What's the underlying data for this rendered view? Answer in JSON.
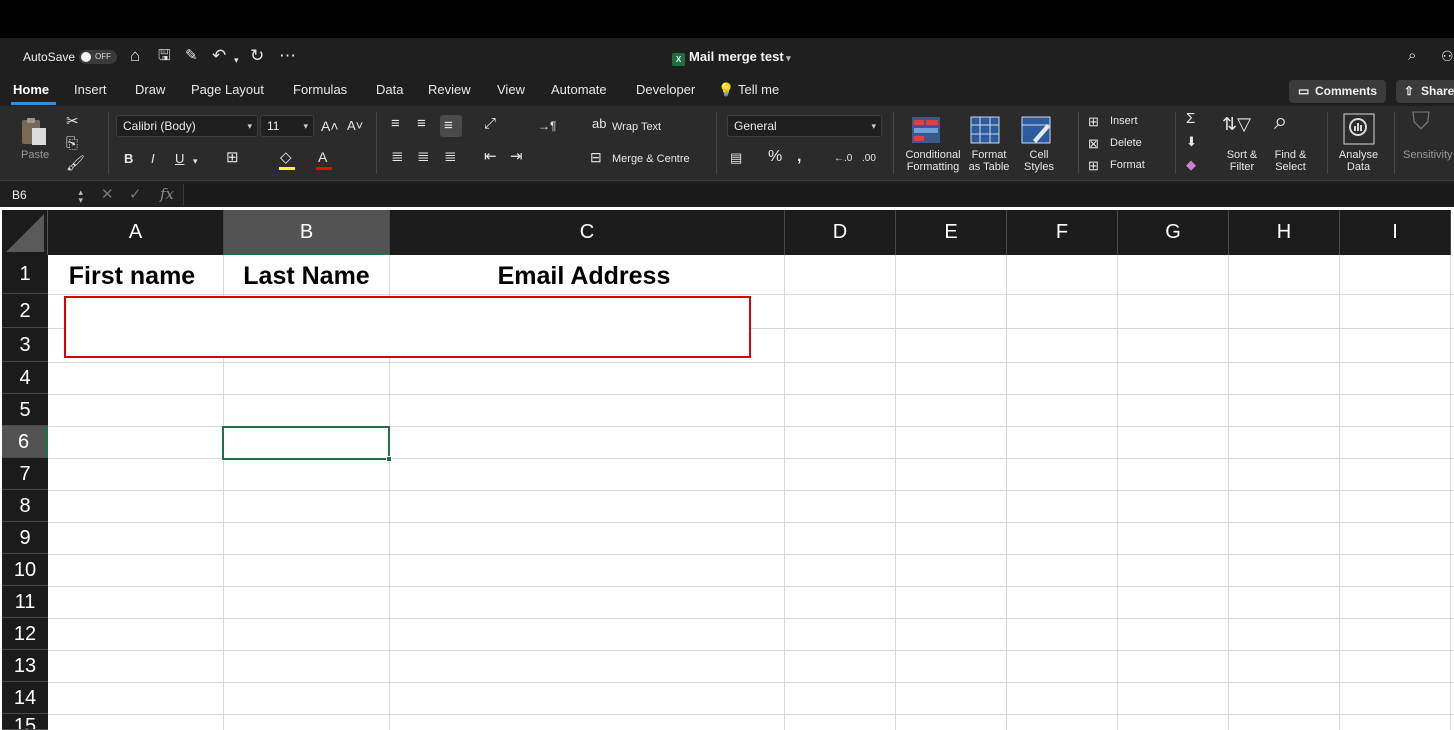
{
  "title_bar": {
    "autosave_label": "AutoSave",
    "autosave_state": "OFF",
    "document_title": "Mail merge test"
  },
  "tabs": [
    {
      "label": "Home",
      "active": true
    },
    {
      "label": "Insert"
    },
    {
      "label": "Draw"
    },
    {
      "label": "Page Layout"
    },
    {
      "label": "Formulas"
    },
    {
      "label": "Data"
    },
    {
      "label": "Review"
    },
    {
      "label": "View"
    },
    {
      "label": "Automate"
    },
    {
      "label": "Developer"
    },
    {
      "label": "Tell me"
    }
  ],
  "header_buttons": {
    "comments": "Comments",
    "share": "Share"
  },
  "ribbon": {
    "paste": "Paste",
    "font_name": "Calibri (Body)",
    "font_size": "11",
    "wrap_text": "Wrap Text",
    "merge_centre": "Merge & Centre",
    "number_format": "General",
    "conditional_formatting": [
      "Conditional",
      "Formatting"
    ],
    "format_as_table": [
      "Format",
      "as Table"
    ],
    "cell_styles": [
      "Cell",
      "Styles"
    ],
    "insert": "Insert",
    "delete": "Delete",
    "format": "Format",
    "sort_filter": [
      "Sort &",
      "Filter"
    ],
    "find_select": [
      "Find &",
      "Select"
    ],
    "analyse_data": [
      "Analyse",
      "Data"
    ],
    "sensitivity": "Sensitivity"
  },
  "formula_bar": {
    "name_box": "B6",
    "fx": "fx",
    "value": ""
  },
  "sheet": {
    "columns": [
      "A",
      "B",
      "C",
      "D",
      "E",
      "F",
      "G",
      "H",
      "I"
    ],
    "selected_column": "B",
    "rows": [
      "1",
      "2",
      "3",
      "4",
      "5",
      "6",
      "7",
      "8",
      "9",
      "10",
      "11",
      "12",
      "13",
      "14",
      "15"
    ],
    "selected_row": "6",
    "header_row": {
      "A": "First name",
      "B": "Last Name",
      "C": "Email Address"
    }
  },
  "colors": {
    "accent_green": "#1e7145",
    "highlight_red": "#e00000",
    "tab_underline": "#2f8fde"
  }
}
